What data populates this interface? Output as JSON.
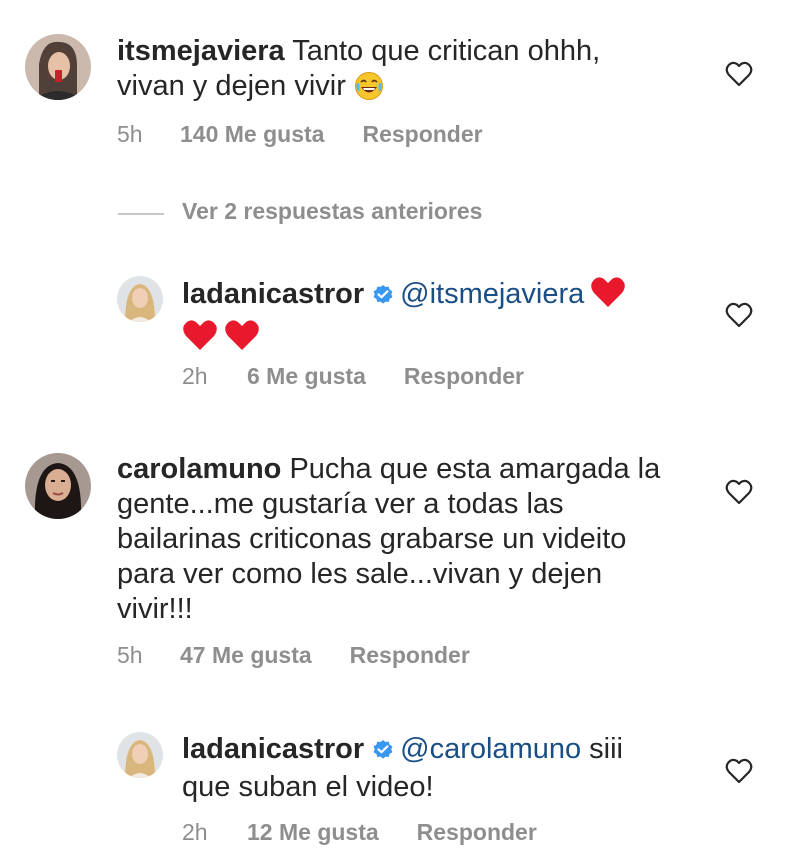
{
  "comments": [
    {
      "username": "itsmejaviera",
      "text_line1": "Tanto que critican ohhh,",
      "text_line2": "vivan y dejen vivir",
      "emoji": "face-with-tears-of-joy",
      "time": "5h",
      "likes": "140 Me gusta",
      "reply": "Responder"
    },
    {
      "username": "ladanicastror",
      "verified": true,
      "mention": "@itsmejaviera",
      "time": "2h",
      "likes": "6 Me gusta",
      "reply": "Responder"
    },
    {
      "username": "carolamuno",
      "text_line1": "Pucha que esta amargada la",
      "text_line2": "gente...me gustaría ver a todas las",
      "text_line3": "bailarinas criticonas grabarse un videito",
      "text_line4": "para ver como les sale...vivan y dejen",
      "text_line5": "vivir!!!",
      "time": "5h",
      "likes": "47 Me gusta",
      "reply": "Responder"
    },
    {
      "username": "ladanicastror",
      "verified": true,
      "mention": "@carolamuno",
      "text_line1": "siii",
      "text_line2": "que suban el video!",
      "time": "2h",
      "likes": "12 Me gusta",
      "reply": "Responder"
    }
  ],
  "view_replies": "Ver 2 respuestas anteriores",
  "colors": {
    "text": "#262626",
    "meta": "#8e8e8e",
    "mention": "#1a4f86",
    "verified": "#3897f0",
    "heart_emoji": "#e8192c"
  }
}
